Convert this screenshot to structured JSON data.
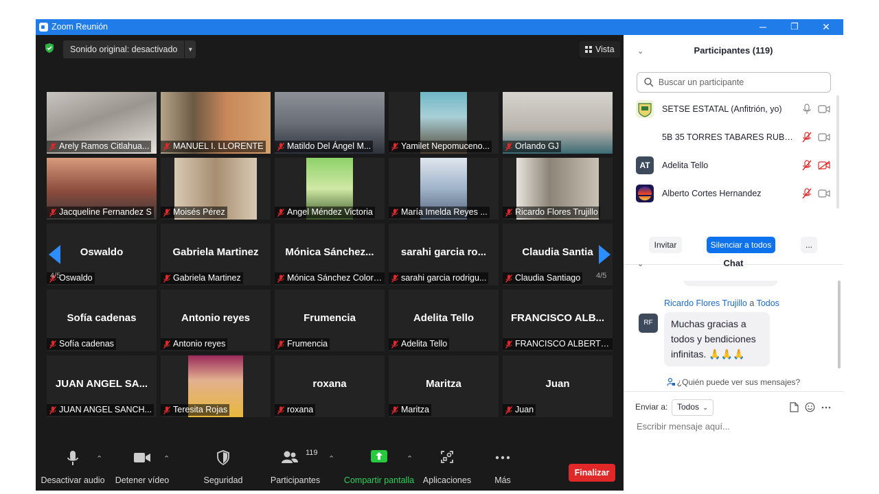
{
  "window": {
    "title": "Zoom Reunión",
    "minimize": "─",
    "restore": "❐",
    "close": "✕"
  },
  "topbar": {
    "sound": "Sonido original: desactivado",
    "vista": "Vista"
  },
  "pager": {
    "left_page": "4/5",
    "right_page": "4/5"
  },
  "tiles": [
    {
      "big": "",
      "label": "Arely Ramos Citlahua..."
    },
    {
      "big": "",
      "label": "MANUEL I. LLORENTE"
    },
    {
      "big": "",
      "label": "Matildo Del Ángel M..."
    },
    {
      "big": "",
      "label": "Yamilet Nepomuceno..."
    },
    {
      "big": "",
      "label": "Orlando GJ"
    },
    {
      "big": "",
      "label": "Jacqueline Fernandez S"
    },
    {
      "big": "",
      "label": "Moisés Pérez"
    },
    {
      "big": "",
      "label": "Angel Méndez Victoria"
    },
    {
      "big": "",
      "label": "María Imelda Reyes ..."
    },
    {
      "big": "",
      "label": "Ricardo Flores Trujillo"
    },
    {
      "big": "Oswaldo",
      "label": "Oswaldo"
    },
    {
      "big": "Gabriela Martinez",
      "label": "Gabriela Martinez"
    },
    {
      "big": "Mónica  Sánchez...",
      "label": "Mónica Sánchez Colorado"
    },
    {
      "big": "sarahi  garcia  ro...",
      "label": "sarahi garcia rodrigu..."
    },
    {
      "big": "Claudia  Santia",
      "label": "Claudia Santiago"
    },
    {
      "big": "Sofía cadenas",
      "label": "Sofía cadenas"
    },
    {
      "big": "Antonio reyes",
      "label": "Antonio reyes"
    },
    {
      "big": "Frumencia",
      "label": "Frumencia"
    },
    {
      "big": "Adelita Tello",
      "label": "Adelita Tello"
    },
    {
      "big": "FRANCISCO  ALB...",
      "label": "FRANCISCO ALBERTO..."
    },
    {
      "big": "JUAN  ANGEL  SA...",
      "label": "JUAN ANGEL SANCH..."
    },
    {
      "big": "",
      "label": "Teresita Rojas"
    },
    {
      "big": "roxana",
      "label": "roxana"
    },
    {
      "big": "Maritza",
      "label": "Maritza"
    },
    {
      "big": "Juan",
      "label": "Juan"
    }
  ],
  "toolbar": {
    "audio": "Desactivar audio",
    "video": "Detener vídeo",
    "security": "Seguridad",
    "participants": "Participantes",
    "participants_count": "119",
    "share": "Compartir pantalla",
    "apps": "Aplicaciones",
    "more": "Más",
    "end": "Finalizar"
  },
  "participants": {
    "title": "Participantes (119)",
    "search_placeholder": "Buscar un participante",
    "list": [
      {
        "name": "SETSE ESTATAL (Anfitrión, yo)",
        "initials": ""
      },
      {
        "name": "5B 35 TORRES TABARES RUBEN ...",
        "initials": ""
      },
      {
        "name": "Adelita Tello",
        "initials": "AT"
      },
      {
        "name": "Alberto Cortes Hernandez",
        "initials": ""
      }
    ],
    "invite": "Invitar",
    "mute_all": "Silenciar a todos",
    "more": "..."
  },
  "chat": {
    "title": "Chat",
    "sender": "Ricardo Flores Trujillo",
    "to_word": "a",
    "recipient": "Todos",
    "avatar": "RF",
    "message": "Muchas gracias  a todos y bendiciones infinitas. 🙏🙏🙏",
    "who_can_see": "¿Quién puede ver sus mensajes?",
    "send_to_label": "Enviar a:",
    "send_to_value": "Todos",
    "input_placeholder": "Escribir mensaje aquí..."
  },
  "colors": {
    "titlebar": "#1f7ce8",
    "end_button": "#e02828",
    "share_green": "#27c93f",
    "link_blue": "#1d6ac8",
    "mute_red": "#e02828"
  }
}
